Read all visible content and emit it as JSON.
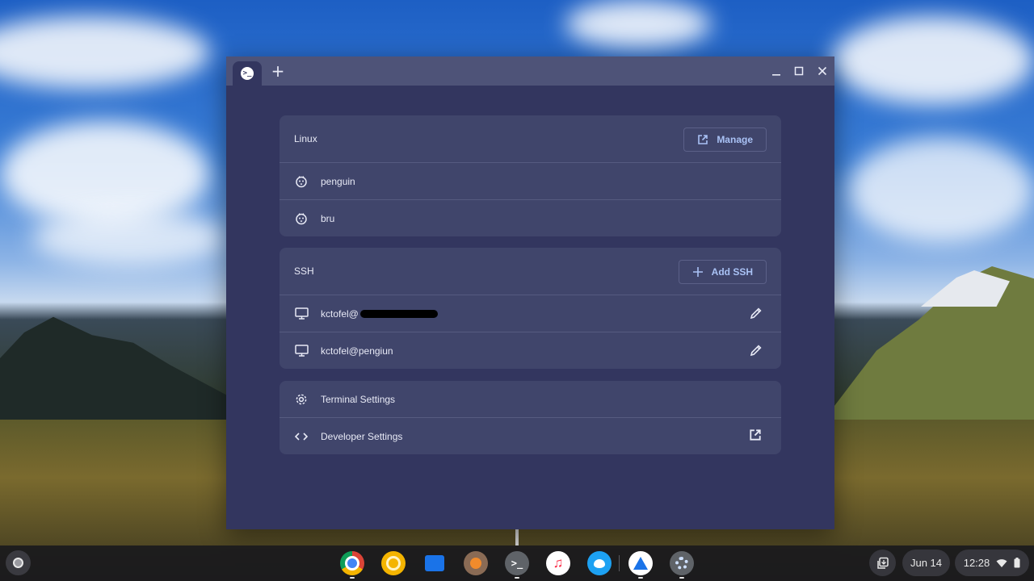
{
  "tab": {
    "icon": "terminal-icon"
  },
  "window_controls": {
    "new_tab": "+",
    "minimize": "minimize-icon",
    "maximize": "maximize-icon",
    "close": "close-icon"
  },
  "linux": {
    "title": "Linux",
    "manage_label": "Manage",
    "containers": [
      {
        "name": "penguin",
        "icon": "penguin-icon"
      },
      {
        "name": "bru",
        "icon": "penguin-icon"
      }
    ]
  },
  "ssh": {
    "title": "SSH",
    "add_label": "Add SSH",
    "connections": [
      {
        "name": "kctofel@",
        "redacted": true,
        "icon": "computer-icon"
      },
      {
        "name": "kctofel@pengiun",
        "redacted": false,
        "icon": "computer-icon"
      }
    ]
  },
  "settings": {
    "terminal_label": "Terminal Settings",
    "developer_label": "Developer Settings"
  },
  "shelf": {
    "apps": [
      "chrome",
      "chrome-canary",
      "files",
      "sketchbook",
      "terminal",
      "music",
      "twitter",
      "beaker",
      "settings"
    ],
    "date": "Jun 14",
    "time": "12:28"
  },
  "colors": {
    "window_bg": "#33365f",
    "card_bg": "#40456b",
    "accent": "#a9c2f5"
  }
}
